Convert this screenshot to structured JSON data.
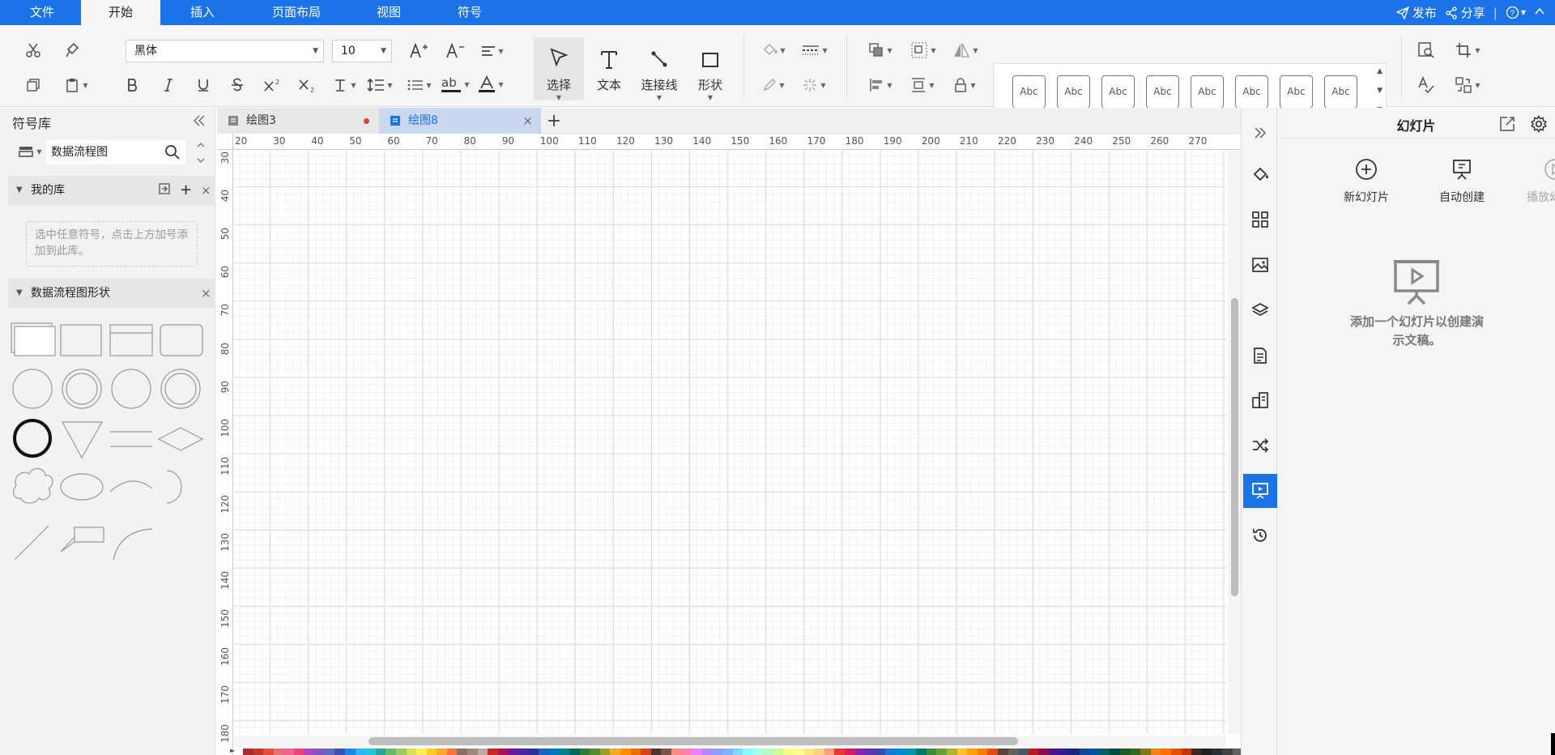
{
  "menubar": {
    "tabs": [
      "文件",
      "开始",
      "插入",
      "页面布局",
      "视图",
      "符号"
    ],
    "active": "开始",
    "publish": "发布",
    "share": "分享",
    "sep": "|"
  },
  "ribbon": {
    "font_name": "黑体",
    "font_size": "10",
    "select_label": "选择",
    "text_label": "文本",
    "connector_label": "连接线",
    "shape_label": "形状",
    "style_swatch": [
      "Abc",
      "Abc",
      "Abc",
      "Abc",
      "Abc",
      "Abc",
      "Abc",
      "Abc"
    ],
    "icons": [
      "cut-icon",
      "format-painter-icon",
      "copy-icon",
      "paste-icon",
      "font-grow-icon",
      "font-shrink-icon",
      "align-icon",
      "bold-icon",
      "italic-icon",
      "underline-icon",
      "strikethrough-icon",
      "superscript-icon",
      "subscript-icon",
      "text-case-icon",
      "line-spacing-icon",
      "list-icon",
      "highlight-icon",
      "font-color-icon",
      "fill-icon",
      "line-style-icon",
      "line-color-icon",
      "effects-icon",
      "arrange-icon",
      "group-icon",
      "flip-icon",
      "align-objects-icon",
      "distribute-icon",
      "lock-icon",
      "find-icon",
      "crop-icon",
      "spellcheck-icon",
      "replace-icon"
    ]
  },
  "left": {
    "title": "符号库",
    "library_select": "数据流程图",
    "my_library": "我的库",
    "my_library_hint": "选中任意符号，点击上方加号添加到此库。",
    "shapes_section": "数据流程图形状"
  },
  "tabs": {
    "doc1": "绘图3",
    "doc2": "绘图8",
    "add": "+"
  },
  "ruler": {
    "h": [
      "20",
      "30",
      "40",
      "50",
      "60",
      "70",
      "80",
      "90",
      "100",
      "110",
      "120",
      "130",
      "140",
      "150",
      "160",
      "170",
      "180",
      "190",
      "200",
      "210",
      "220",
      "230",
      "240",
      "250",
      "260",
      "270"
    ],
    "v": [
      "30",
      "40",
      "50",
      "60",
      "70",
      "80",
      "90",
      "100",
      "110",
      "120",
      "130",
      "140",
      "150",
      "160",
      "170",
      "180"
    ]
  },
  "right": {
    "title": "幻灯片",
    "new_slide": "新幻灯片",
    "auto_create": "自动创建",
    "play_slide": "播放幻灯片",
    "empty_line1": "添加一个幻灯片以创建演",
    "empty_line2": "示文稿。"
  },
  "rail_icons": [
    "collapse-icon",
    "fill-bucket-icon",
    "grid-icon",
    "image-icon",
    "layers-icon",
    "page-icon",
    "data-icon",
    "shuffle-icon",
    "slideshow-icon",
    "history-icon"
  ],
  "colors": {
    "accent": "#1a73e8",
    "modified_dot": "#d9443a"
  },
  "palette": [
    "#a82e2e",
    "#c0392b",
    "#e74c3c",
    "#e57373",
    "#f06292",
    "#ec407a",
    "#ab47bc",
    "#7e57c2",
    "#5c6bc0",
    "#3f51b5",
    "#1e88e5",
    "#29b6f6",
    "#26c6da",
    "#26a69a",
    "#66bb6a",
    "#9ccc65",
    "#d4e157",
    "#ffee58",
    "#ffca28",
    "#ffa726",
    "#ff7043",
    "#8d6e63",
    "#a1887f",
    "#bcaaa4",
    "#c62828",
    "#ad1457",
    "#6a1b9a",
    "#4527a0",
    "#283593",
    "#1565c0",
    "#0277bd",
    "#00838f",
    "#00695c",
    "#2e7d32",
    "#558b2f",
    "#9e9d24",
    "#f9a825",
    "#ff8f00",
    "#ef6c00",
    "#d84315",
    "#4e342e",
    "#795548",
    "#ff8a80",
    "#ff80ab",
    "#ea80fc",
    "#b388ff",
    "#8c9eff",
    "#82b1ff",
    "#80d8ff",
    "#84ffff",
    "#a7ffeb",
    "#b9f6ca",
    "#ccff90",
    "#f4ff81",
    "#ffff8d",
    "#ffe57f",
    "#ffd180",
    "#ff9e80",
    "#e53935",
    "#d81b60",
    "#8e24aa",
    "#5e35b1",
    "#3949ab",
    "#1976d2",
    "#0288d1",
    "#0097a7",
    "#00796b",
    "#388e3c",
    "#689f38",
    "#afb42b",
    "#fbc02d",
    "#ffa000",
    "#f57c00",
    "#e64a19",
    "#5d4037",
    "#616161",
    "#455a64",
    "#b71c1c",
    "#880e4f",
    "#4a148c",
    "#311b92",
    "#1a237e",
    "#0d47a1",
    "#01579b",
    "#006064",
    "#004d40",
    "#1b5e20",
    "#33691e",
    "#827717",
    "#f57f17",
    "#ff6f00",
    "#e65100",
    "#bf360c",
    "#3e2723",
    "#212121",
    "#263238",
    "#424242",
    "#616161",
    "#757575",
    "#9e9e9e",
    "#bdbdbd",
    "#e0e0e0",
    "#eeeeee",
    "#f5f5f5"
  ]
}
